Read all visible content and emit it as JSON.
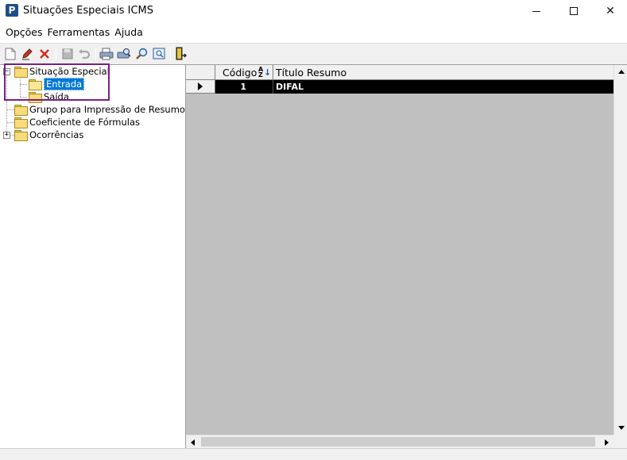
{
  "window": {
    "title": "Situações Especiais ICMS",
    "app_icon_letter": "P"
  },
  "menu": {
    "items": [
      {
        "label": "Opções"
      },
      {
        "label": "Ferramentas"
      },
      {
        "label": "Ajuda"
      }
    ]
  },
  "toolbar": {
    "icons": [
      "new-document-icon",
      "edit-pencil-icon",
      "delete-x-icon",
      "save-disk-icon",
      "undo-icon",
      "print-icon",
      "print-preview-icon",
      "search-magnifier-icon",
      "zoom-frame-icon",
      "exit-door-icon"
    ]
  },
  "tree": {
    "nodes": [
      {
        "label": "Situação Especial",
        "expanded": true
      },
      {
        "label": "Entrada",
        "selected": true
      },
      {
        "label": "Saída"
      },
      {
        "label": "Grupo para Impressão de Resumo"
      },
      {
        "label": "Coeficiente de Fórmulas"
      },
      {
        "label": "Ocorrências",
        "expanded": false
      }
    ],
    "expander_expanded": "−",
    "expander_collapsed": "+"
  },
  "grid": {
    "columns": [
      {
        "label": "Código"
      },
      {
        "label": "Título Resumo"
      }
    ],
    "sort_icon_text_top": "A",
    "sort_icon_text_bottom": "Z",
    "sort_arrow": "↓",
    "rows": [
      {
        "codigo": "1",
        "titulo": "DIFAL"
      }
    ]
  },
  "colors": {
    "selection": "#0078d7",
    "highlight_box": "#7a1f86",
    "grid_background": "#c0c0c0",
    "selected_row": "#000000"
  }
}
